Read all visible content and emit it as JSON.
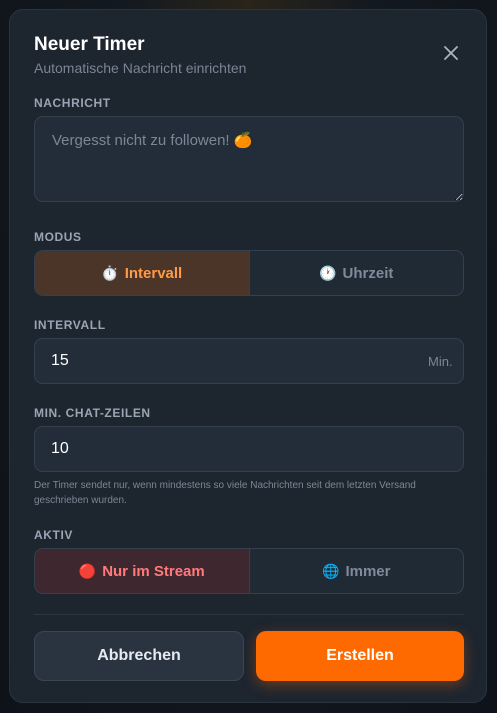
{
  "modal": {
    "title": "Neuer Timer",
    "subtitle": "Automatische Nachricht einrichten"
  },
  "message": {
    "label": "NACHRICHT",
    "placeholder": "Vergesst nicht zu followen! 🍊"
  },
  "mode": {
    "label": "MODUS",
    "options": [
      {
        "icon": "⏱️",
        "label": "Intervall",
        "active": true
      },
      {
        "icon": "🕐",
        "label": "Uhrzeit",
        "active": false
      }
    ]
  },
  "interval": {
    "label": "INTERVALL",
    "value": "15",
    "unit": "Min."
  },
  "min_lines": {
    "label": "MIN. CHAT-ZEILEN",
    "value": "10",
    "hint": "Der Timer sendet nur, wenn mindestens so viele Nachrichten seit dem letzten Versand geschrieben wurden."
  },
  "active": {
    "label": "AKTIV",
    "options": [
      {
        "icon": "🔴",
        "label": "Nur im Stream",
        "active": true
      },
      {
        "icon": "🌐",
        "label": "Immer",
        "active": false
      }
    ]
  },
  "actions": {
    "cancel_label": "Abbrechen",
    "create_label": "Erstellen"
  },
  "colors": {
    "accent": "#ff6a00",
    "modal_bg": "#1d252f",
    "active_mode_text": "#ff9a45",
    "active_stream_text": "#ff7b7b"
  }
}
